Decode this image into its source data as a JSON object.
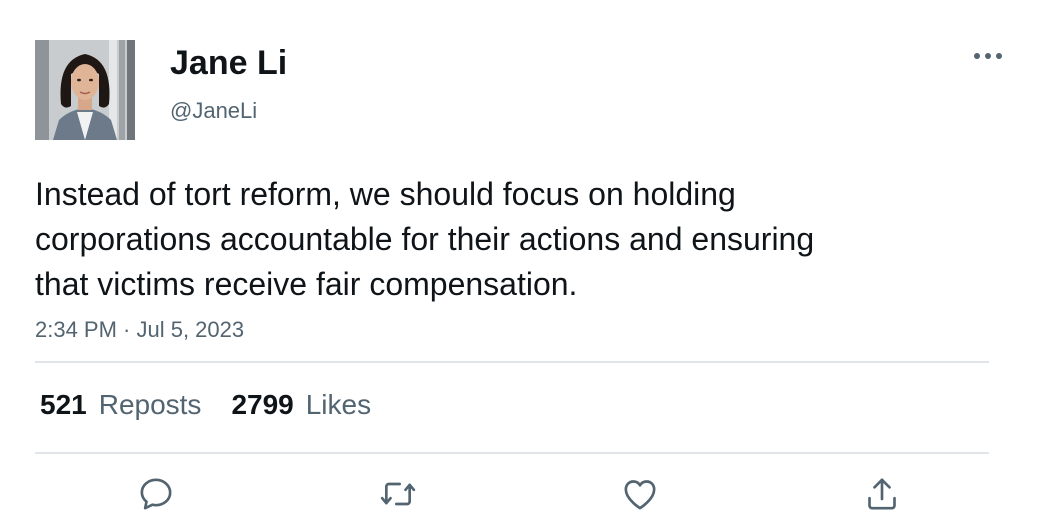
{
  "tweet": {
    "author": {
      "display_name": "Jane Li",
      "handle": "@JaneLi"
    },
    "text": "Instead of tort reform, we should focus on holding corporations accountable for their actions and ensuring that victims receive fair compensation.",
    "timestamp": "2:34 PM · Jul 5, 2023",
    "stats": {
      "reposts_count": "521",
      "reposts_label": "Reposts",
      "likes_count": "2799",
      "likes_label": "Likes"
    }
  },
  "icons": {
    "more": "more-horizontal-icon",
    "reply": "reply-icon",
    "repost": "repost-icon",
    "like": "heart-icon",
    "share": "share-icon"
  },
  "colors": {
    "text_primary": "#0f1419",
    "text_secondary": "#536471",
    "divider": "#e1e4e8"
  }
}
